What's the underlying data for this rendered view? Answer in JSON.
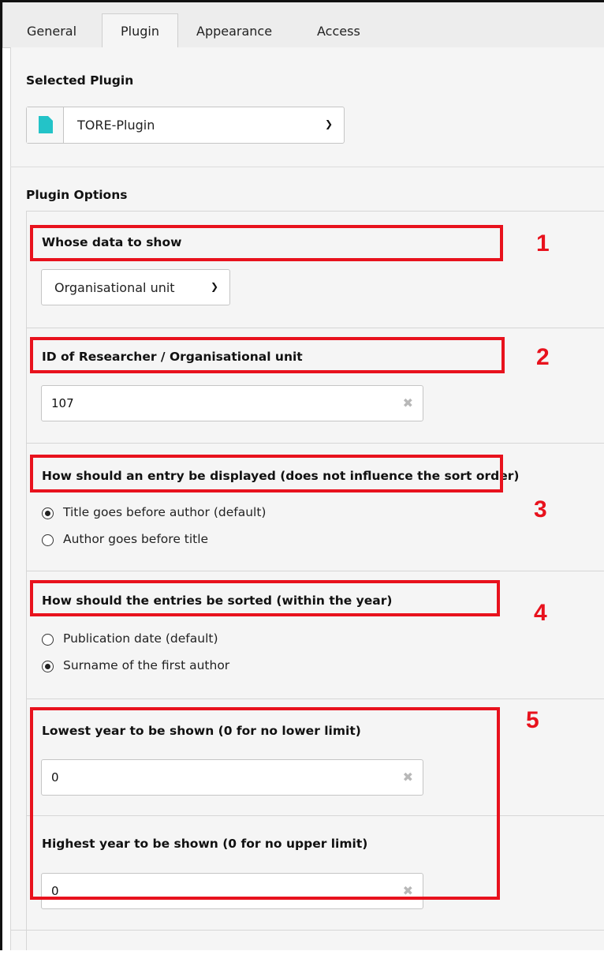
{
  "tabs": [
    "General",
    "Plugin",
    "Appearance",
    "Access"
  ],
  "selected_plugin": {
    "heading": "Selected Plugin",
    "value": "TORE-Plugin",
    "icon": "document-icon",
    "icon_color": "#23c3c8"
  },
  "plugin_options": {
    "heading": "Plugin Options",
    "whose_data": {
      "label": "Whose data to show",
      "value": "Organisational unit"
    },
    "id_field": {
      "label": "ID of Researcher / Organisational unit",
      "value": "107"
    },
    "display": {
      "label": "How should an entry be displayed (does not influence the sort order)",
      "options": [
        "Title goes before author (default)",
        "Author goes before title"
      ],
      "selected": 0
    },
    "sorting": {
      "label": "How should the entries be sorted (within the year)",
      "options": [
        "Publication date (default)",
        "Surname of the first author"
      ],
      "selected": 1
    },
    "lowest_year": {
      "label": "Lowest year to be shown (0 for no lower limit)",
      "value": "0"
    },
    "highest_year": {
      "label": "Highest year to be shown (0 for no upper limit)",
      "value": "0"
    }
  },
  "annotations": [
    "1",
    "2",
    "3",
    "4",
    "5"
  ],
  "colors": {
    "annotation": "#e8121d",
    "panel": "#f5f5f5",
    "tabbar": "#ededed"
  }
}
